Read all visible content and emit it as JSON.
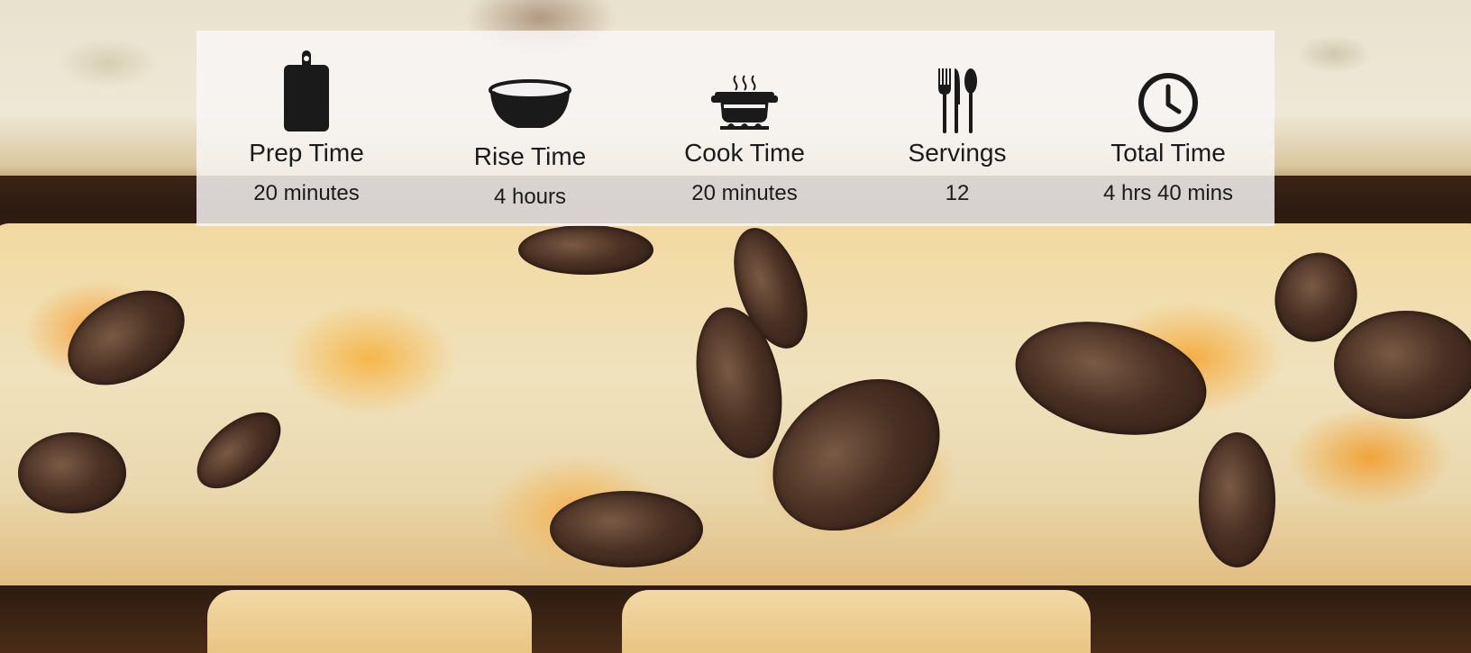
{
  "recipe_stats": [
    {
      "icon": "cutting-board-icon",
      "label": "Prep Time",
      "value": "20 minutes"
    },
    {
      "icon": "bowl-icon",
      "label": "Rise Time",
      "value": "4 hours"
    },
    {
      "icon": "cooking-pot-icon",
      "label": "Cook Time",
      "value": "20 minutes"
    },
    {
      "icon": "cutlery-icon",
      "label": "Servings",
      "value": "12"
    },
    {
      "icon": "clock-icon",
      "label": "Total Time",
      "value": "4 hrs 40 mins"
    }
  ],
  "colors": {
    "overlay": "#f8f6f6",
    "icon": "#1a1a1a",
    "text": "#1b1b1b"
  }
}
